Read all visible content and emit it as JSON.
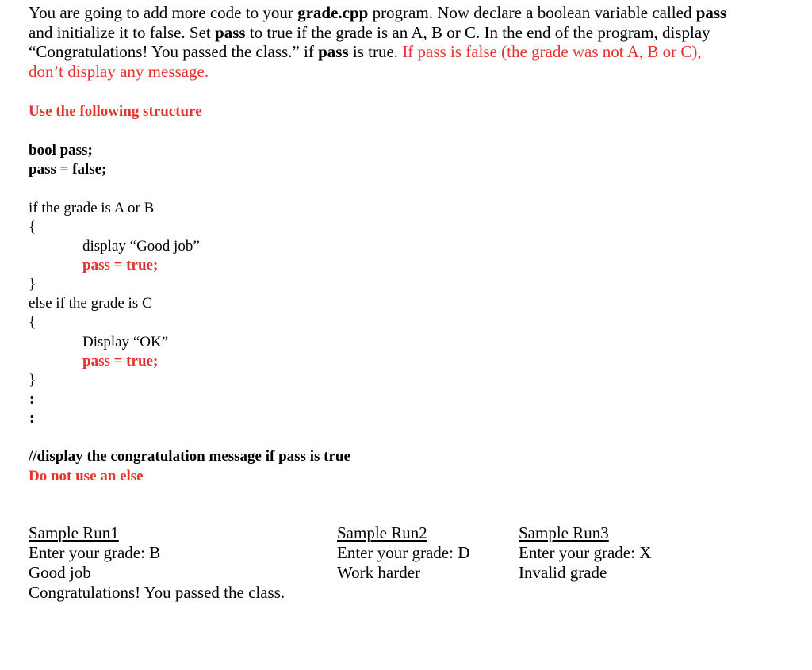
{
  "intro": {
    "line1": {
      "a": "You are going to add more code to your ",
      "b_bold": "grade.cpp",
      "c": " program. Now declare a boolean variable called ",
      "d_bold": "pass"
    },
    "line2": {
      "a": "and initialize it to false. Set ",
      "b_bold": "pass",
      "c": " to true if the grade is an A, B or C. In the end of the program, display"
    },
    "line3": {
      "a": "“Congratulations! You passed the class.” if ",
      "b_bold": "pass",
      "c": " is true. ",
      "d_red": "If pass is false (the grade was not A, B or C),"
    },
    "line4_red": "don’t display any message."
  },
  "structure_heading": "Use the following structure",
  "code": {
    "decl1": "bool pass;",
    "decl2": "pass = false;",
    "if_line": "if the grade is A or B",
    "open_brace_1": "{",
    "display_good": "display “Good job”",
    "pass_true_1": "pass = true;",
    "close_brace_1": "}",
    "elseif_line": "else if the grade is C",
    "open_brace_2": "{",
    "display_ok": "Display “OK”",
    "pass_true_2": "pass = true;",
    "close_brace_2": "}",
    "ellipsis_1": ":",
    "ellipsis_2": ":",
    "comment": "//display the congratulation message if pass is true",
    "note_red": "Do not use an else"
  },
  "sample_runs": [
    {
      "title": "Sample Run1",
      "lines": [
        "Enter your grade: B",
        "Good job",
        "Congratulations! You passed the class."
      ]
    },
    {
      "title": "Sample Run2",
      "lines": [
        "Enter your grade: D",
        "Work harder"
      ]
    },
    {
      "title": "Sample Run3",
      "lines": [
        "Enter your grade: X",
        "Invalid grade"
      ]
    }
  ],
  "colors": {
    "accent_red": "#e8322c",
    "text": "#000000"
  }
}
